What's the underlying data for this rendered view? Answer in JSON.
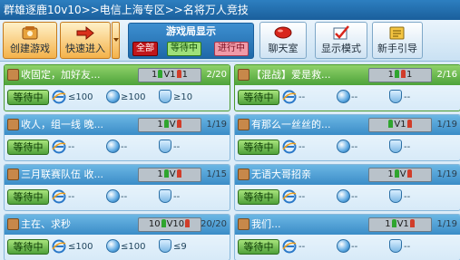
{
  "window": {
    "title": "群雄逐鹿10v10>>电信上海专区>>名将万人竞技"
  },
  "toolbar": {
    "create_label": "创建游戏",
    "quick_join_label": "快速进入",
    "display": {
      "title": "游戏局显示",
      "filters": [
        "全部",
        "等待中",
        "进行中"
      ],
      "selected": "全部"
    },
    "chat_label": "聊天室",
    "display_mode_label": "显示模式",
    "guide_label": "新手引导"
  },
  "rooms": [
    {
      "name": "收固定，加好友...",
      "slot": {
        "left": "1",
        "mid": "V1",
        "right": "1"
      },
      "count": "2/20",
      "state": "等待中",
      "stat_a": "≤100",
      "stat_b": "≥100",
      "stat_c": "≥10",
      "highlighted": true
    },
    {
      "name": "【混战】爱是救...",
      "slot": {
        "left": "1",
        "mid": "",
        "right": "1"
      },
      "count": "2/16",
      "state": "等待中",
      "stat_a": "--",
      "stat_b": "--",
      "stat_c": "--",
      "highlighted": true
    },
    {
      "name": "收人，组一线 晚...",
      "slot": {
        "left": "1",
        "mid": "V",
        "right": ""
      },
      "count": "1/19",
      "state": "等待中",
      "stat_a": "--",
      "stat_b": "--",
      "stat_c": "--",
      "highlighted": false
    },
    {
      "name": "有那么一丝丝的...",
      "slot": {
        "left": "",
        "mid": "V1",
        "right": ""
      },
      "count": "1/19",
      "state": "等待中",
      "stat_a": "--",
      "stat_b": "--",
      "stat_c": "--",
      "highlighted": false
    },
    {
      "name": "三月联赛队伍 收...",
      "slot": {
        "left": "1",
        "mid": "V",
        "right": ""
      },
      "count": "1/15",
      "state": "等待中",
      "stat_a": "--",
      "stat_b": "--",
      "stat_c": "--",
      "highlighted": false
    },
    {
      "name": "无语大哥招亲",
      "slot": {
        "left": "1",
        "mid": "V",
        "right": ""
      },
      "count": "1/19",
      "state": "等待中",
      "stat_a": "--",
      "stat_b": "--",
      "stat_c": "--",
      "highlighted": false
    },
    {
      "name": "主在、求秒",
      "slot": {
        "left": "10",
        "mid": "V10",
        "right": ""
      },
      "count": "20/20",
      "state": "等待中",
      "stat_a": "≤100",
      "stat_b": "≤100",
      "stat_c": "≤9",
      "highlighted": false
    },
    {
      "name": "我们...",
      "slot": {
        "left": "1",
        "mid": "V1",
        "right": ""
      },
      "count": "1/19",
      "state": "等待中",
      "stat_a": "--",
      "stat_b": "--",
      "stat_c": "--",
      "highlighted": false
    }
  ]
}
